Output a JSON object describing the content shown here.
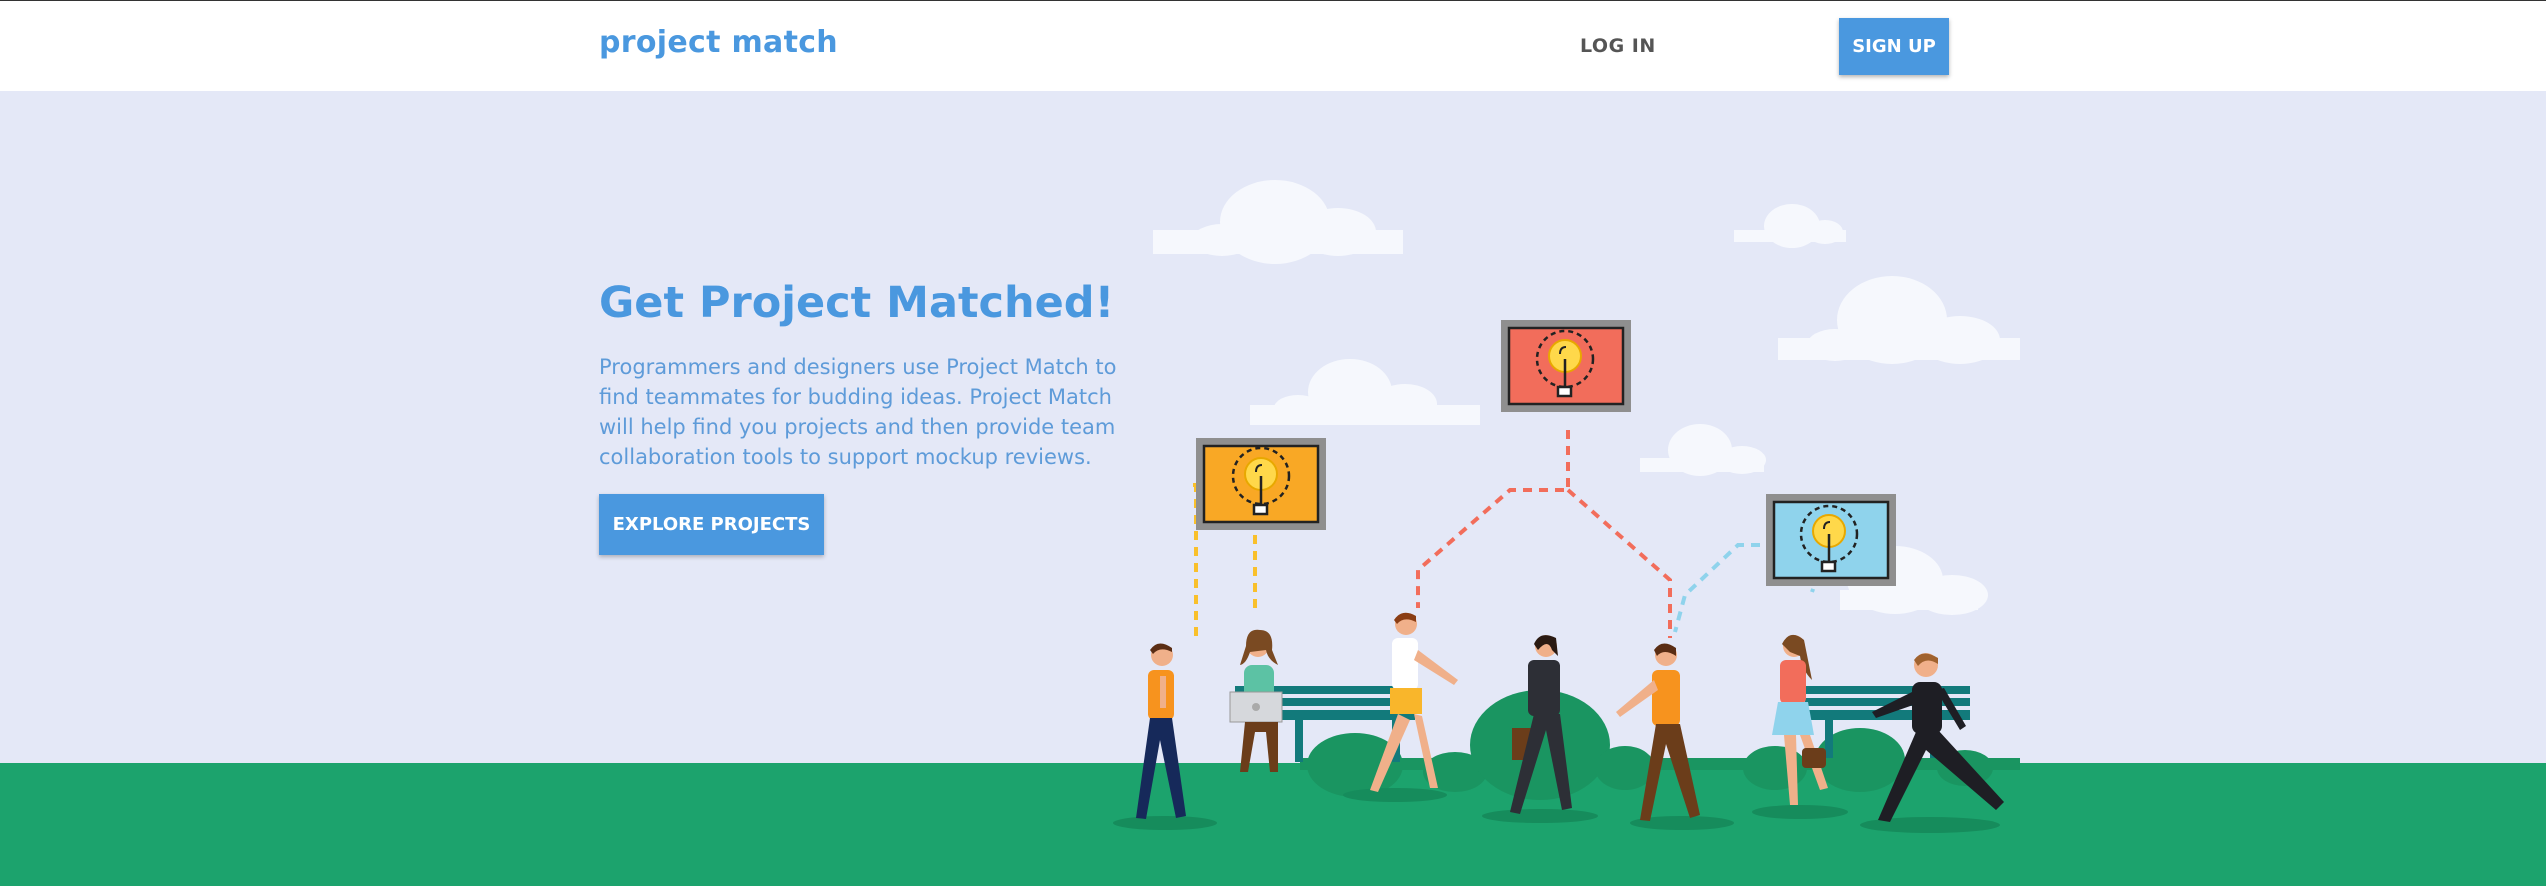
{
  "nav": {
    "brand": "project match",
    "login_label": "LOG IN",
    "signup_label": "SIGN UP"
  },
  "hero": {
    "title": "Get Project Matched!",
    "description": "Programmers and designers use Project Match to find teammates for budding ideas. Project Match will help find you projects and then provide team collaboration tools to support mockup reviews.",
    "cta_label": "EXPLORE PROJECTS"
  },
  "illustration": {
    "screen_icons": [
      "lightbulb-icon",
      "lightbulb-icon",
      "lightbulb-icon"
    ],
    "screen_colors": [
      "#f9a825",
      "#f26d5b",
      "#8fd3ec"
    ]
  },
  "colors": {
    "accent": "#4a98df",
    "hero_background": "#e4e8f7",
    "ground": "#1ca36d"
  }
}
